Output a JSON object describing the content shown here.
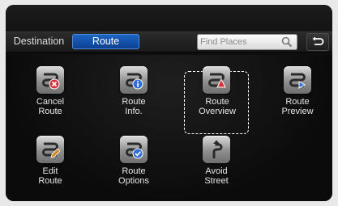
{
  "tabs": {
    "destination": "Destination",
    "route": "Route"
  },
  "search": {
    "placeholder": "Find Places",
    "icon": "magnifier-icon"
  },
  "back_icon": "back-arrow-icon",
  "menu": [
    {
      "line1": "Cancel",
      "line2": "Route",
      "icon": "cancel-route-icon",
      "badge_color": "#d8323c"
    },
    {
      "line1": "Route",
      "line2": "Info.",
      "icon": "route-info-icon",
      "badge_color": "#2f6fd6"
    },
    {
      "line1": "Route",
      "line2": "Overview",
      "icon": "route-overview-icon",
      "badge_color": "#d8323c",
      "selected": true
    },
    {
      "line1": "Route",
      "line2": "Preview",
      "icon": "route-preview-icon",
      "badge_color": "#2f6fd6"
    },
    {
      "line1": "Edit",
      "line2": "Route",
      "icon": "edit-route-icon",
      "badge_color": "#d08a2a"
    },
    {
      "line1": "Route",
      "line2": "Options",
      "icon": "route-options-icon",
      "badge_color": "#2f6fd6"
    },
    {
      "line1": "Avoid",
      "line2": "Street",
      "icon": "avoid-street-icon",
      "badge_color": ""
    }
  ]
}
